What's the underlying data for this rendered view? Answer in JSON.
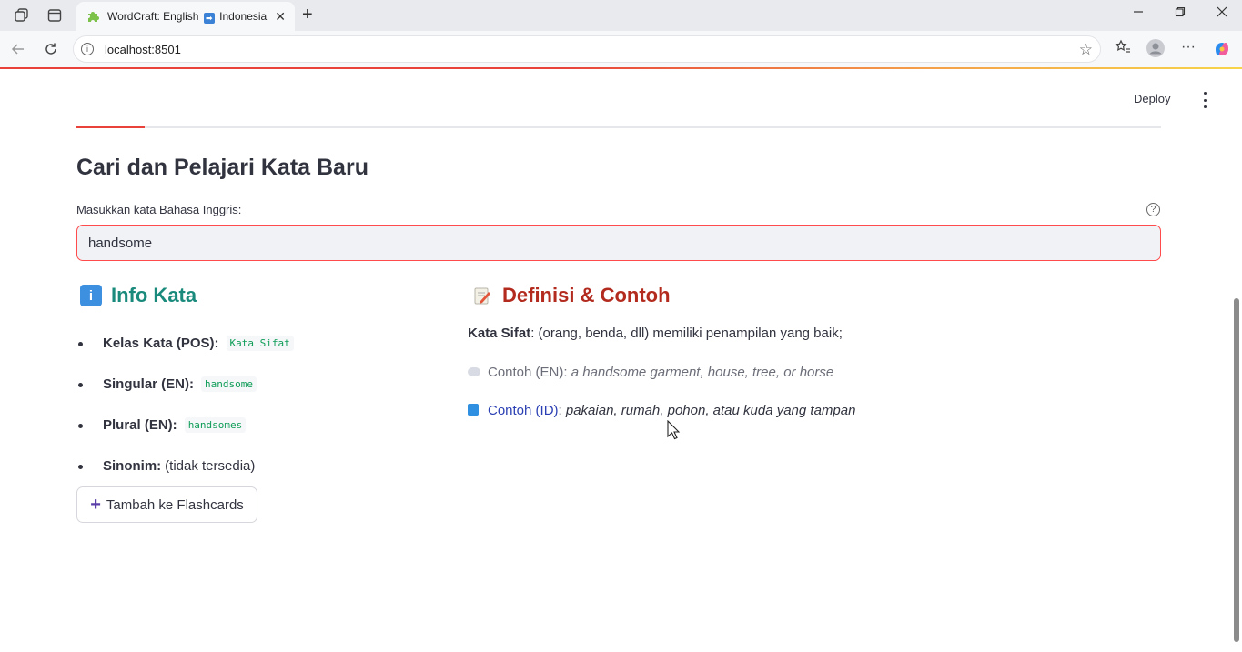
{
  "browser": {
    "tab_title": "WordCraft: English",
    "tab_title_suffix": "Indonesia",
    "tab_arrow": "➡",
    "url": "localhost:8501",
    "new_tab": "+",
    "close": "✕"
  },
  "app": {
    "deploy_label": "Deploy",
    "title": "Cari dan Pelajari Kata Baru",
    "input_label": "Masukkan kata Bahasa Inggris:",
    "input_value": "handsome",
    "help_glyph": "?"
  },
  "info": {
    "heading": "Info Kata",
    "icon_glyph": "i",
    "items": [
      {
        "key": "Kelas Kata (POS):",
        "value": "Kata Sifat"
      },
      {
        "key": "Singular (EN):",
        "value": "handsome"
      },
      {
        "key": "Plural (EN):",
        "value": "handsomes"
      },
      {
        "key": "Sinonim:",
        "value": "(tidak tersedia)"
      }
    ],
    "add_button_label": "Tambah ke Flashcards",
    "add_button_icon": "+"
  },
  "definition": {
    "heading": "Definisi & Contoh",
    "pos_label": "Kata Sifat",
    "pos_text": ": (orang, benda, dll) memiliki penampilan yang baik;",
    "example_en_label": "Contoh (EN):",
    "example_en": "a handsome garment, house, tree, or horse",
    "example_id_label": "Contoh (ID)",
    "example_id": "pakaian, rumah, pohon, atau kuda yang tampan"
  },
  "colors": {
    "accent": "#ff4b4b",
    "info_heading": "#1a8a7c",
    "definition_heading": "#b32b1e",
    "code_text": "#0f9d58"
  }
}
